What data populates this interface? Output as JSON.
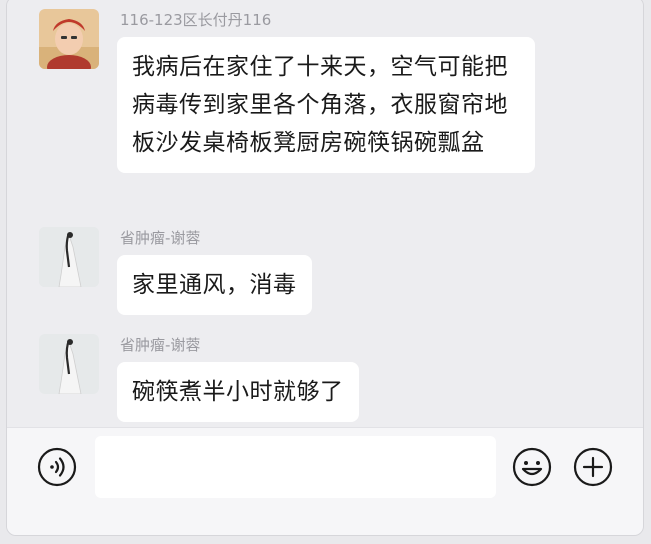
{
  "messages": [
    {
      "sender": "116-123区长付丹116",
      "text": "我病后在家住了十来天，空气可能把病毒传到家里各个角落，衣服窗帘地板沙发桌椅板凳厨房碗筷锅碗瓢盆"
    },
    {
      "sender": "省肿瘤-谢蓉",
      "text": "家里通风，消毒"
    },
    {
      "sender": "省肿瘤-谢蓉",
      "text": "碗筷煮半小时就够了"
    }
  ],
  "input": {
    "value": "",
    "placeholder": ""
  },
  "icons": {
    "voice": "voice-icon",
    "emoji": "emoji-icon",
    "plus": "plus-icon"
  }
}
